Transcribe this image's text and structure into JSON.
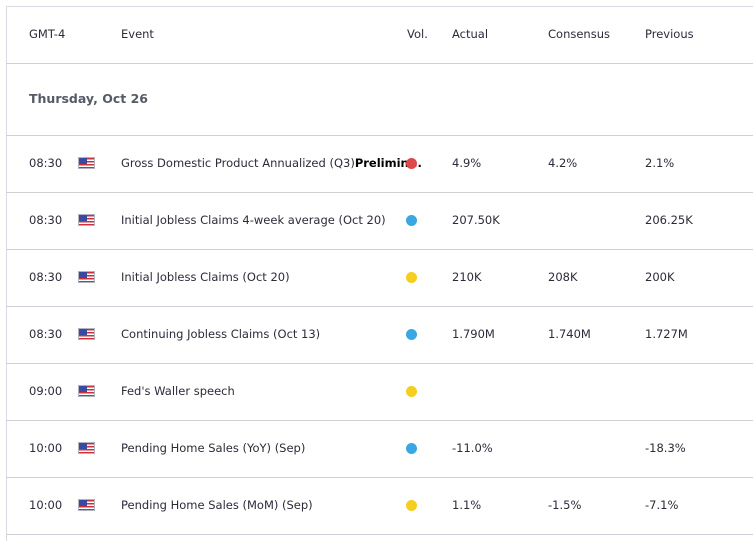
{
  "header": {
    "timezone": "GMT-4",
    "event": "Event",
    "vol": "Vol.",
    "actual": "Actual",
    "consensus": "Consensus",
    "previous": "Previous"
  },
  "date_heading": "Thursday, Oct 26",
  "colors": {
    "high": "#e0474c",
    "medium": "#f5cf1b",
    "low": "#3aa7e0"
  },
  "rows": [
    {
      "time": "08:30",
      "event": "Gross Domestic Product Annualized (Q3)",
      "event_suffix": "Prelimin...",
      "volatility": "high",
      "actual": "4.9%",
      "consensus": "4.2%",
      "previous": "2.1%"
    },
    {
      "time": "08:30",
      "event": "Initial Jobless Claims 4-week average (Oct 20)",
      "event_suffix": "",
      "volatility": "low",
      "actual": "207.50K",
      "consensus": "",
      "previous": "206.25K"
    },
    {
      "time": "08:30",
      "event": "Initial Jobless Claims (Oct 20)",
      "event_suffix": "",
      "volatility": "medium",
      "actual": "210K",
      "consensus": "208K",
      "previous": "200K"
    },
    {
      "time": "08:30",
      "event": "Continuing Jobless Claims (Oct 13)",
      "event_suffix": "",
      "volatility": "low",
      "actual": "1.790M",
      "consensus": "1.740M",
      "previous": "1.727M"
    },
    {
      "time": "09:00",
      "event": "Fed's Waller speech",
      "event_suffix": "",
      "volatility": "medium",
      "actual": "",
      "consensus": "",
      "previous": ""
    },
    {
      "time": "10:00",
      "event": "Pending Home Sales (YoY) (Sep)",
      "event_suffix": "",
      "volatility": "low",
      "actual": "-11.0%",
      "consensus": "",
      "previous": "-18.3%"
    },
    {
      "time": "10:00",
      "event": "Pending Home Sales (MoM) (Sep)",
      "event_suffix": "",
      "volatility": "medium",
      "actual": "1.1%",
      "consensus": "-1.5%",
      "previous": "-7.1%"
    }
  ]
}
